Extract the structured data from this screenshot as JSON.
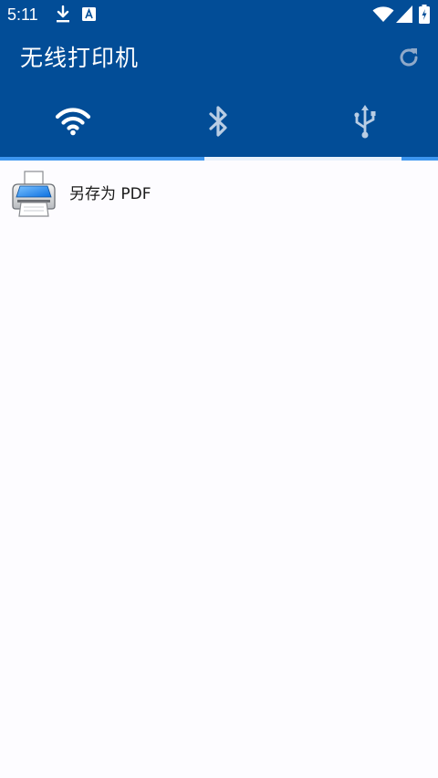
{
  "status_bar": {
    "time": "5:11",
    "icons": [
      "download-icon",
      "a-keyboard-icon",
      "wifi-icon",
      "signal-icon",
      "battery-icon"
    ]
  },
  "appbar": {
    "title": "无线打印机",
    "refresh_icon": "refresh-icon"
  },
  "tabs": [
    {
      "icon": "wifi-icon",
      "selected": false
    },
    {
      "icon": "bluetooth-icon",
      "selected": true
    },
    {
      "icon": "usb-icon",
      "selected": false
    }
  ],
  "printers": [
    {
      "label": "另存为 PDF",
      "icon": "printer-icon"
    }
  ],
  "colors": {
    "primary": "#024d97",
    "tab_track": "#3d96ef",
    "tab_indicator": "#e8f1fb",
    "background": "#fdfcff",
    "text": "#1a1a1a"
  }
}
